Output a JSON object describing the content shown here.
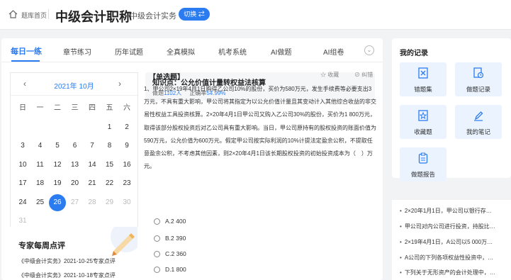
{
  "header": {
    "home_label": "题库首页",
    "title": "中级会计职称",
    "subtitle": "中级会计实务",
    "switch_label": "切换 ⇄"
  },
  "tabs": [
    "每日一练",
    "章节练习",
    "历年试题",
    "全真模拟",
    "机考系统",
    "AI做题",
    "AI组卷"
  ],
  "calendar": {
    "title": "2021年  10月",
    "weekdays": [
      "日",
      "一",
      "二",
      "三",
      "四",
      "五",
      "六"
    ],
    "days": [
      "",
      "",
      "",
      "",
      "",
      "1",
      "2",
      "3",
      "4",
      "5",
      "6",
      "7",
      "8",
      "9",
      "10",
      "11",
      "12",
      "13",
      "14",
      "15",
      "16",
      "17",
      "18",
      "19",
      "20",
      "21",
      "22",
      "23",
      "24",
      "25",
      "26",
      "27",
      "28",
      "29",
      "30",
      "31"
    ],
    "today": "26"
  },
  "review": {
    "title": "专家每周点评",
    "items": [
      "《中级会计实务》2021-10-25专家点评",
      "《中级会计实务》2021-10-18专家点评"
    ]
  },
  "knowledge": {
    "title": "知识点：公允价值计量转权益法核算",
    "count_label": "做题",
    "count": "1102人",
    "rate_label": "正确率",
    "rate": "54.99%"
  },
  "question": {
    "type": "【单选题】",
    "fav": "☆ 收藏",
    "err": "纠错",
    "text": "1、甲公司2×19年4月1日购得乙公司10%的股份，买价为580万元，发生手续费等必要支出3万元，不具有重大影响，甲公司将其指定为以公允价值计量且其变动计入其他综合收益的非交易性权益工具投资核算。2×20年4月1日甲公司又购入乙公司30%的股份，买价为1 800万元，取得该部分股权投资后对乙公司具有重大影响。当日，甲公司原持有的股权投资的账面价值为590万元，公允价值为600万元。假定甲公司按实际利润的10%计提法定盈余公积，不提取任意盈余公积，不考虑其他因素，则2×20年4月1日该长期股权投资的初始投资成本为（　）万元。",
    "options": [
      "A.2 400",
      "B.2 390",
      "C.2 360",
      "D.1 800"
    ]
  },
  "records": {
    "title": "我的记录",
    "items": [
      "错题集",
      "做题记录",
      "收藏题",
      "我的笔记",
      "做题报告"
    ]
  },
  "news": [
    "2×20年1月1日，甲公司以银行存…",
    "甲公司对内公司进行投资，持股比…",
    "2×19年4月1日，A公司以5 000万…",
    "A公司的下列各项权益性投资中，…",
    "下列关于无形资产的会计处理中，…"
  ],
  "colors": {
    "accent": "#2b7cf0",
    "record_bg": "#eaf3fe"
  }
}
